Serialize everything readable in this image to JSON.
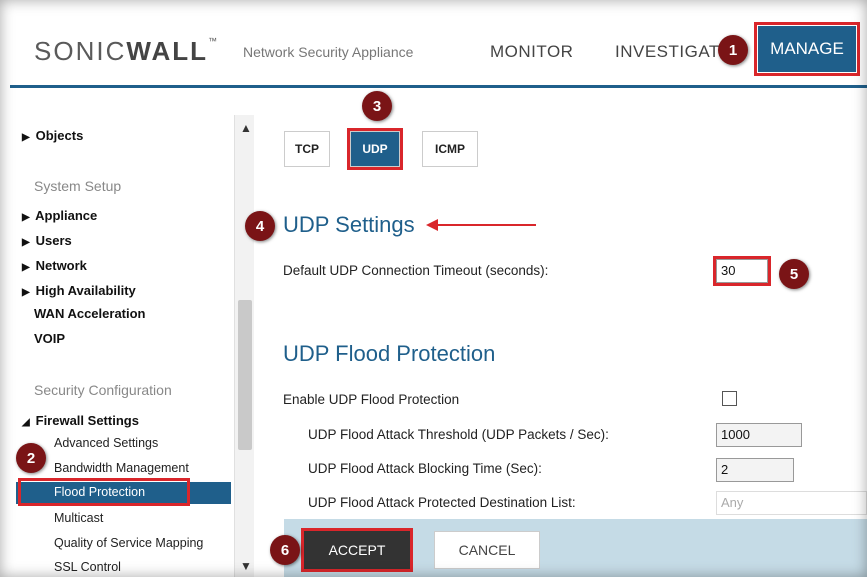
{
  "header": {
    "logo_light": "SONIC",
    "logo_bold": "WALL",
    "logo_mark": "™",
    "product": "Network Security Appliance",
    "nav": {
      "monitor": "MONITOR",
      "investigate": "INVESTIGATE",
      "manage": "MANAGE"
    }
  },
  "sidebar": {
    "objects": "Objects",
    "system_setup": "System Setup",
    "appliance": "Appliance",
    "users": "Users",
    "network": "Network",
    "high_availability": "High Availability",
    "wan_acceleration": "WAN Acceleration",
    "voip": "VOIP",
    "security_configuration": "Security Configuration",
    "firewall_settings": "Firewall Settings",
    "sub": {
      "advanced": "Advanced Settings",
      "bandwidth": "Bandwidth Management",
      "flood": "Flood Protection",
      "multicast": "Multicast",
      "qos": "Quality of Service Mapping",
      "ssl": "SSL Control"
    }
  },
  "tabs": {
    "tcp": "TCP",
    "udp": "UDP",
    "icmp": "ICMP"
  },
  "udp_settings": {
    "title": "UDP Settings",
    "timeout_label": "Default UDP Connection Timeout (seconds):",
    "timeout_value": "30"
  },
  "flood": {
    "title": "UDP Flood Protection",
    "enable_label": "Enable UDP Flood Protection",
    "enable_checked": false,
    "threshold_label": "UDP Flood Attack Threshold (UDP Packets / Sec):",
    "threshold_value": "1000",
    "blocking_label": "UDP Flood Attack Blocking Time (Sec):",
    "blocking_value": "2",
    "dest_label": "UDP Flood Attack Protected Destination List:",
    "dest_value": "Any"
  },
  "footer": {
    "accept": "ACCEPT",
    "cancel": "CANCEL"
  },
  "steps": [
    "1",
    "2",
    "3",
    "4",
    "5",
    "6"
  ],
  "colors": {
    "accent": "#1f5f8b",
    "highlight": "#d9262b",
    "badge": "#7a1416"
  }
}
